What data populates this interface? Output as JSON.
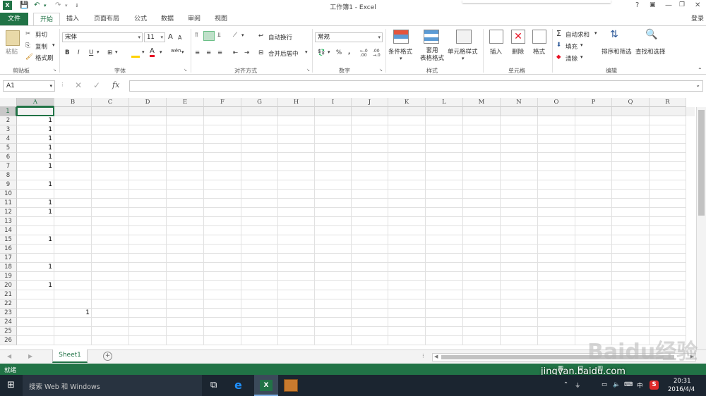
{
  "window": {
    "title": "工作簿1 - Excel",
    "help": "?",
    "login": "登录"
  },
  "tabs": [
    "文件",
    "开始",
    "插入",
    "页面布局",
    "公式",
    "数据",
    "审阅",
    "视图"
  ],
  "ribbon": {
    "clipboard": {
      "paste": "粘贴",
      "cut": "剪切",
      "copy": "复制",
      "format_painter": "格式刷",
      "label": "剪贴板"
    },
    "font": {
      "name": "宋体",
      "size": "11",
      "bold": "B",
      "italic": "I",
      "underline": "U",
      "label": "字体",
      "grow": "A",
      "shrink": "A",
      "color_letter": "A",
      "phonetic": "wén"
    },
    "alignment": {
      "wrap": "自动换行",
      "merge": "合并后居中",
      "label": "对齐方式"
    },
    "number": {
      "format": "常规",
      "percent": "%",
      "comma": ",",
      "label": "数字",
      "inc_decimal": "←.0 .00",
      "dec_decimal": ".00 →.0"
    },
    "styles": {
      "conditional": "条件格式",
      "table": "套用\n表格格式",
      "cell_styles": "单元格样式",
      "label": "样式"
    },
    "cells": {
      "insert": "插入",
      "delete": "删除",
      "format": "格式",
      "label": "单元格"
    },
    "editing": {
      "autosum": "自动求和",
      "fill": "填充",
      "clear": "清除",
      "sort": "排序和筛选",
      "find": "查找和选择",
      "label": "编辑"
    }
  },
  "formula_bar": {
    "name_box": "A1",
    "fx": "fx",
    "value": ""
  },
  "grid": {
    "columns": [
      "A",
      "B",
      "C",
      "D",
      "E",
      "F",
      "G",
      "H",
      "I",
      "J",
      "K",
      "L",
      "M",
      "N",
      "O",
      "P",
      "Q",
      "R"
    ],
    "rows": [
      "1",
      "2",
      "3",
      "4",
      "5",
      "6",
      "7",
      "8",
      "9",
      "10",
      "11",
      "12",
      "13",
      "14",
      "15",
      "16",
      "17",
      "18",
      "19",
      "20",
      "21",
      "22",
      "23",
      "24",
      "25",
      "26"
    ],
    "cells": [
      {
        "ref": "A2",
        "value": "1"
      },
      {
        "ref": "A3",
        "value": "1"
      },
      {
        "ref": "A4",
        "value": "1"
      },
      {
        "ref": "A5",
        "value": "1"
      },
      {
        "ref": "A6",
        "value": "1"
      },
      {
        "ref": "A7",
        "value": "1"
      },
      {
        "ref": "A9",
        "value": "1"
      },
      {
        "ref": "A11",
        "value": "1"
      },
      {
        "ref": "A12",
        "value": "1"
      },
      {
        "ref": "A15",
        "value": "1"
      },
      {
        "ref": "A18",
        "value": "1"
      },
      {
        "ref": "A20",
        "value": "1"
      },
      {
        "ref": "B23",
        "value": "1"
      }
    ],
    "active_cell": "A1"
  },
  "sheets": {
    "tabs": [
      "Sheet1"
    ],
    "active": "Sheet1",
    "add": "+"
  },
  "status": {
    "text": "就绪"
  },
  "taskbar": {
    "search": "搜索 Web 和 Windows",
    "time": "20:31",
    "date": "2016/4/4",
    "ime": "中"
  },
  "watermark": {
    "text": "Baidu经验",
    "url": "jingyan.baidu.com"
  },
  "colors": {
    "excel_green": "#217346",
    "taskbar": "#1b2530",
    "header_bg": "#f3f3f3"
  }
}
